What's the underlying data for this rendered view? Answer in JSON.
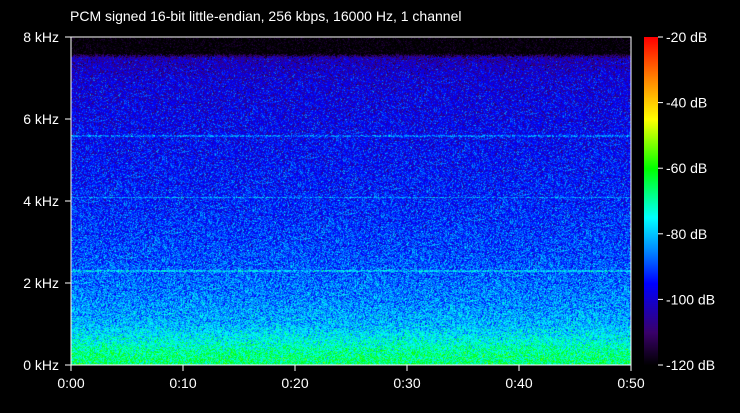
{
  "chart_data": {
    "type": "heatmap",
    "title": "PCM signed 16-bit little-endian, 256 kbps, 16000 Hz, 1 channel",
    "xlabel": "",
    "ylabel": "",
    "x_ticks": [
      "0:00",
      "0:10",
      "0:20",
      "0:30",
      "0:40",
      "0:50"
    ],
    "y_ticks": [
      "0 kHz",
      "2 kHz",
      "4 kHz",
      "6 kHz",
      "8 kHz"
    ],
    "colorbar_ticks": [
      "-20 dB",
      "-40 dB",
      "-60 dB",
      "-80 dB",
      "-100 dB",
      "-120 dB"
    ],
    "xlim": [
      0,
      50
    ],
    "ylim": [
      0,
      8
    ],
    "colorbar_range": [
      -120,
      -20
    ],
    "x_unit": "seconds",
    "y_unit": "kHz",
    "colorbar_unit": "dB",
    "grid": false,
    "noise_floor_cutoff_khz": 7.6,
    "level_profile": [
      {
        "freq_khz": 0.0,
        "db": -66
      },
      {
        "freq_khz": 0.3,
        "db": -68
      },
      {
        "freq_khz": 0.6,
        "db": -74
      },
      {
        "freq_khz": 1.0,
        "db": -81
      },
      {
        "freq_khz": 1.6,
        "db": -85
      },
      {
        "freq_khz": 2.5,
        "db": -89
      },
      {
        "freq_khz": 4.0,
        "db": -93
      },
      {
        "freq_khz": 5.5,
        "db": -96
      },
      {
        "freq_khz": 7.0,
        "db": -99
      },
      {
        "freq_khz": 7.5,
        "db": -103
      },
      {
        "freq_khz": 7.6,
        "db": -120
      },
      {
        "freq_khz": 8.0,
        "db": -120
      }
    ],
    "tonal_lines_khz": [
      2.3,
      4.1,
      5.6
    ]
  },
  "colors": {
    "background": "#000000",
    "frame": "#ffffff",
    "colormap": [
      "#000000",
      "#3a006a",
      "#0000ff",
      "#0088ff",
      "#00ffff",
      "#00ff00",
      "#ffff00",
      "#ff8800",
      "#ff0000"
    ]
  }
}
